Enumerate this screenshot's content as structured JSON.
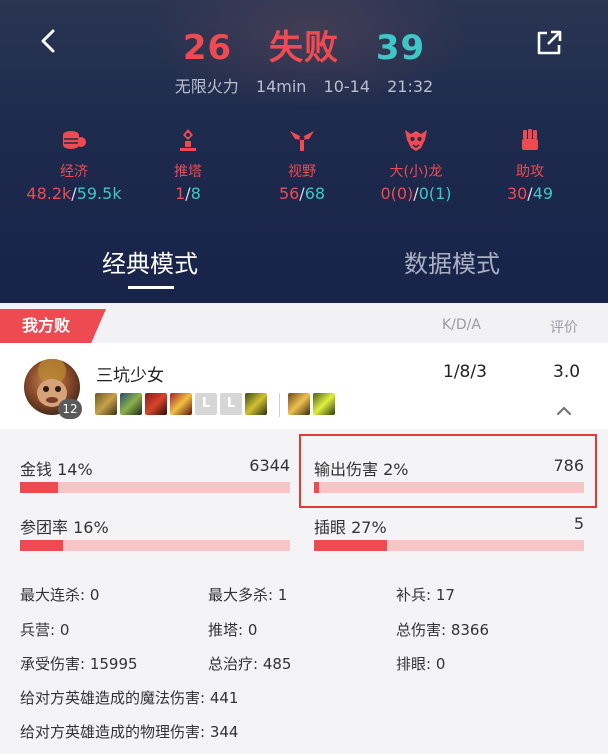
{
  "header": {
    "our_score": "26",
    "result": "失败",
    "enemy_score": "39",
    "mode": "无限火力",
    "duration": "14min",
    "date": "10-14",
    "time": "21:32"
  },
  "team_stats": [
    {
      "icon": "coins-icon",
      "label": "经济",
      "ours": "48.2k",
      "theirs": "59.5k"
    },
    {
      "icon": "tower-icon",
      "label": "推塔",
      "ours": "1",
      "theirs": "8"
    },
    {
      "icon": "ward-icon",
      "label": "视野",
      "ours": "56",
      "theirs": "68"
    },
    {
      "icon": "dragon-icon",
      "label": "大(小)龙",
      "ours": "0(0)",
      "theirs": "0(1)"
    },
    {
      "icon": "fist-icon",
      "label": "助攻",
      "ours": "30",
      "theirs": "49"
    }
  ],
  "tabs": {
    "classic": "经典模式",
    "data": "数据模式"
  },
  "team": {
    "tag": "我方败",
    "kda_header": "K/D/A",
    "rating_header": "评价"
  },
  "player": {
    "name": "三坑少女",
    "level": "12",
    "kda": "1/8/3",
    "rating": "3.0",
    "item_placeholder": "L"
  },
  "metrics": {
    "gold": {
      "label": "金钱 14%",
      "value": "6344",
      "fraction": 0.14
    },
    "damage": {
      "label": "输出伤害 2%",
      "value": "786",
      "fraction": 0.02
    },
    "participation": {
      "label": "参团率 16%",
      "value": "",
      "fraction": 0.16
    },
    "wards": {
      "label": "插眼 27%",
      "value": "5",
      "fraction": 0.27
    }
  },
  "misc": {
    "max_streak": "最大连杀: 0",
    "max_multi": "最大多杀: 1",
    "cs": "补兵: 17",
    "barracks": "兵营: 0",
    "towers": "推塔: 0",
    "total_damage": "总伤害: 8366",
    "damage_taken": "承受伤害: 15995",
    "healing": "总治疗: 485",
    "wards_cleared": "排眼: 0",
    "magic_damage": "给对方英雄造成的魔法伤害: 441",
    "physical_damage": "给对方英雄造成的物理伤害: 344"
  },
  "colors": {
    "accent_red": "#ee4a52",
    "accent_cyan": "#3fc6c6",
    "header_bg": "#1d2a4c",
    "highlight": "#e53935"
  }
}
